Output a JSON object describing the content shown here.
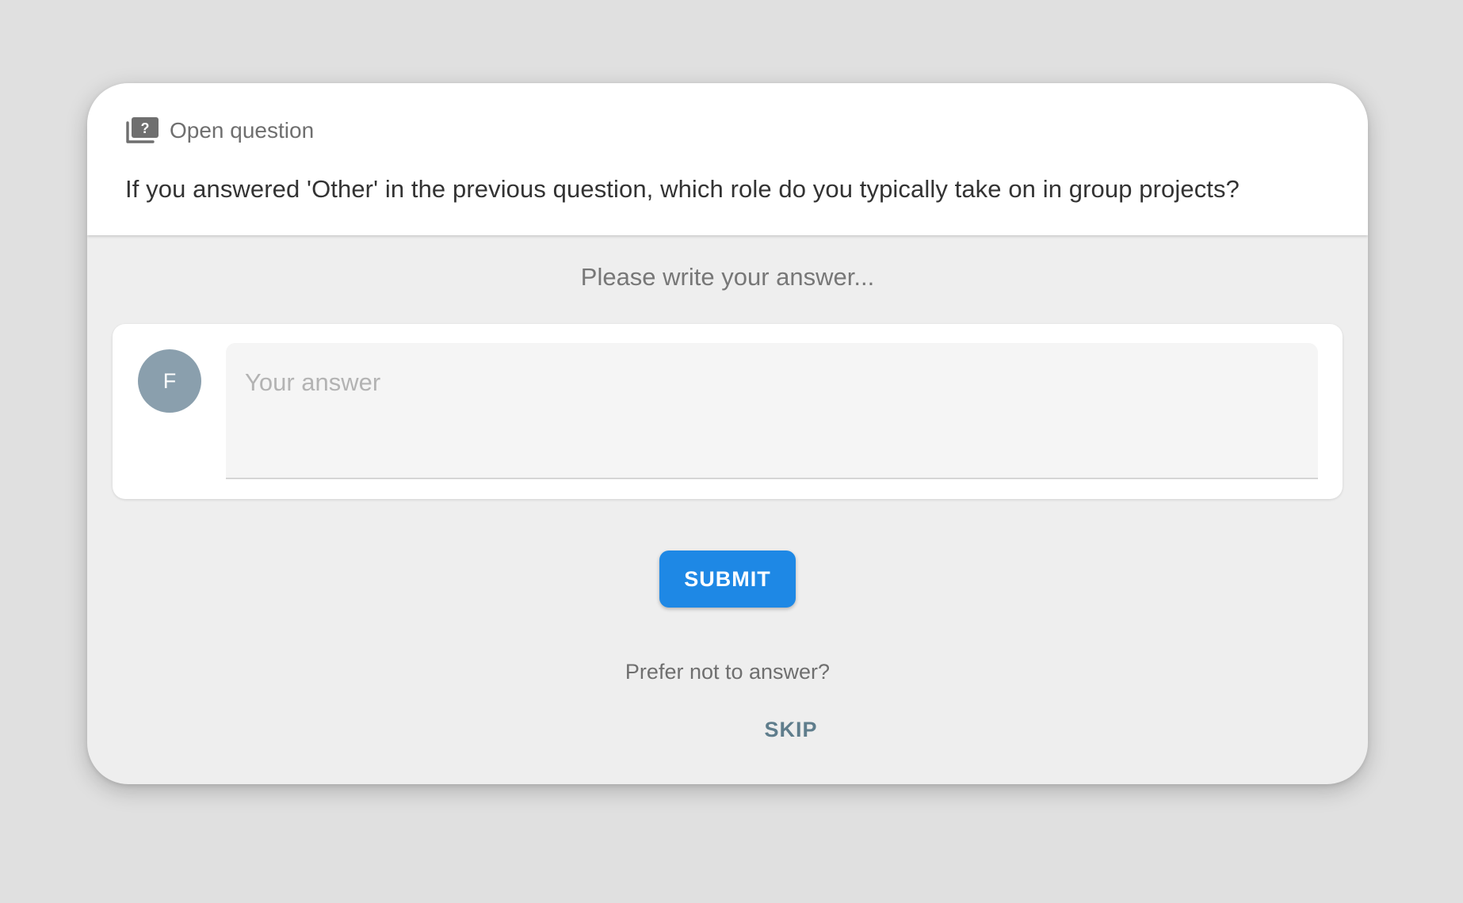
{
  "question": {
    "type_icon": "question-card-icon",
    "type_label": "Open question",
    "text": "If you answered 'Other' in the previous question, which role do you typically take on in group projects?"
  },
  "answer": {
    "prompt": "Please write your answer...",
    "avatar_initial": "F",
    "input_placeholder": "Your answer",
    "input_value": ""
  },
  "actions": {
    "submit_label": "SUBMIT",
    "prefer_not_text": "Prefer not to answer?",
    "skip_label": "SKIP"
  },
  "colors": {
    "accent": "#1e88e5",
    "skip": "#5f7d8c",
    "avatar": "#8a9fad",
    "background": "#e0e0e0"
  }
}
